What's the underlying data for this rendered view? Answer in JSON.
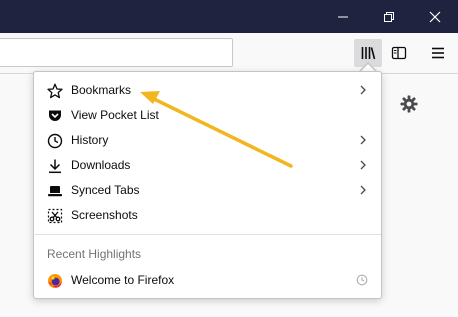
{
  "window": {
    "controls": [
      "minimize-icon",
      "restore-icon",
      "close-icon"
    ],
    "titlebar_color": "#202340"
  },
  "toolbar": {
    "buttons": [
      "library-icon",
      "sidebar-icon",
      "hamburger-menu-icon"
    ]
  },
  "library_menu": {
    "items": [
      {
        "label": "Bookmarks",
        "icon": "star-icon",
        "has_submenu": true
      },
      {
        "label": "View Pocket List",
        "icon": "pocket-icon",
        "has_submenu": false
      },
      {
        "label": "History",
        "icon": "clock-icon",
        "has_submenu": true
      },
      {
        "label": "Downloads",
        "icon": "download-arrow-icon",
        "has_submenu": true
      },
      {
        "label": "Synced Tabs",
        "icon": "synced-tabs-icon",
        "has_submenu": true
      },
      {
        "label": "Screenshots",
        "icon": "scissors-icon",
        "has_submenu": false
      }
    ],
    "recent_highlights": {
      "header": "Recent Highlights",
      "items": [
        {
          "label": "Welcome to Firefox",
          "icon": "firefox-logo-icon",
          "status_icon": "clock-icon"
        }
      ]
    }
  },
  "annotation_arrow": {
    "color": "#f2b61e",
    "points_to": "Bookmarks"
  }
}
